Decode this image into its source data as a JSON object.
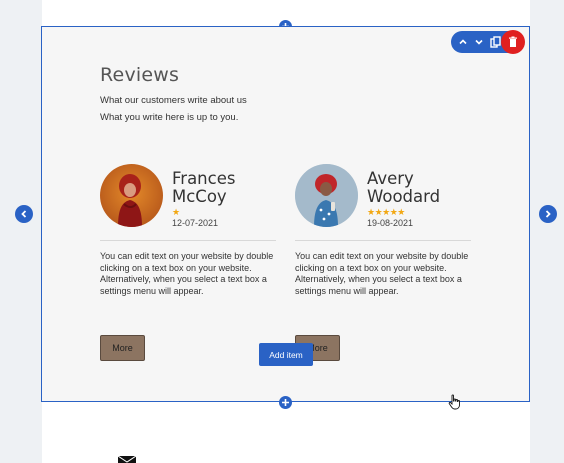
{
  "section": {
    "title": "Reviews",
    "subtitle": "What our customers write about us",
    "subtitle2": "What you write here is up to you."
  },
  "toolbar": {
    "icons": [
      "chevron-up-icon",
      "chevron-down-icon",
      "copy-icon",
      "trash-icon"
    ]
  },
  "reviews": [
    {
      "name": "Frances McCoy",
      "rating": 1,
      "stars": "★",
      "date": "12-07-2021",
      "text": "You can edit text on your website by double clicking on a text box on your website. Alternatively, when you select a text box a settings menu will appear.",
      "button": "More"
    },
    {
      "name": "Avery Woodard",
      "rating": 5,
      "stars": "★★★★★",
      "date": "19-08-2021",
      "text": "You can edit text on your website by double clicking on a text box on your website. Alternatively, when you select a text box a settings menu will appear.",
      "button": "More"
    }
  ],
  "add_item": "Add item",
  "colors": {
    "accent": "#2a62c5",
    "star": "#f2a814",
    "more_button": "#8c7461",
    "delete": "#e02020"
  }
}
